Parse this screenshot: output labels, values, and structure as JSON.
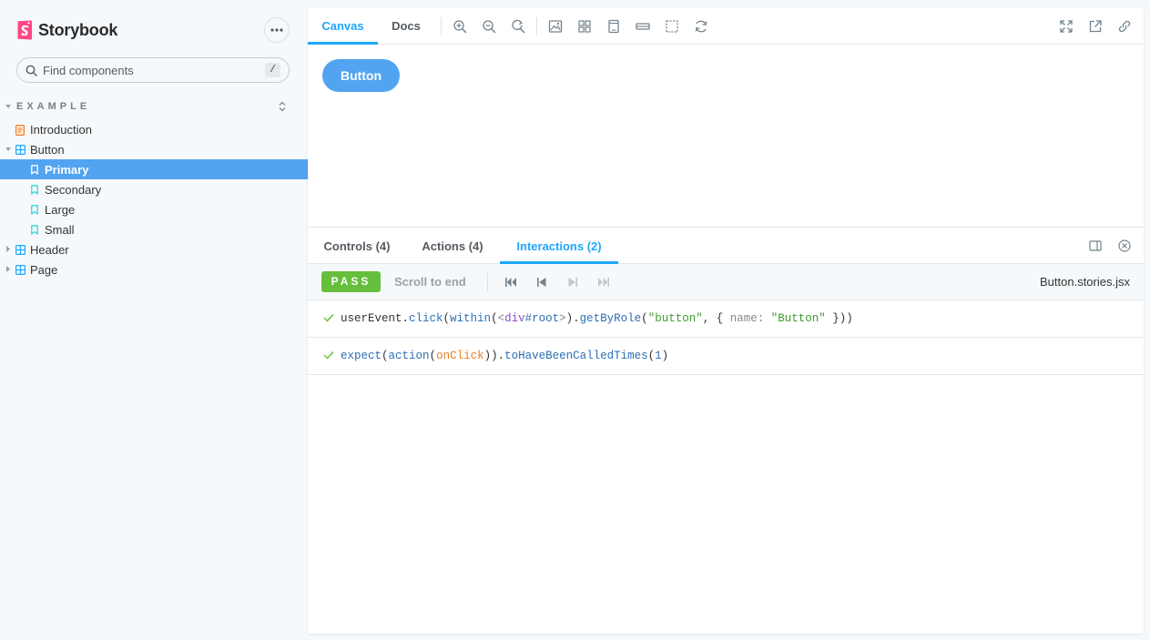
{
  "colors": {
    "accent": "#1ea7fd",
    "selected_bg": "#52a4f1",
    "pass": "#66bf3c",
    "brand_pink": "#ff4785"
  },
  "sidebar": {
    "brand": "Storybook",
    "search_placeholder": "Find components",
    "search_shortcut": "/",
    "group_title": "EXAMPLE",
    "items": [
      {
        "label": "Introduction",
        "icon": "document-icon",
        "depth": 0
      },
      {
        "label": "Button",
        "icon": "component-icon",
        "depth": 0,
        "expanded": true
      },
      {
        "label": "Primary",
        "icon": "bookmark-icon",
        "depth": 1,
        "selected": true
      },
      {
        "label": "Secondary",
        "icon": "bookmark-icon",
        "depth": 1
      },
      {
        "label": "Large",
        "icon": "bookmark-icon",
        "depth": 1
      },
      {
        "label": "Small",
        "icon": "bookmark-icon",
        "depth": 1
      },
      {
        "label": "Header",
        "icon": "component-icon",
        "depth": 0,
        "expanded": false
      },
      {
        "label": "Page",
        "icon": "component-icon",
        "depth": 0,
        "expanded": false
      }
    ]
  },
  "toolbar": {
    "tabs": [
      "Canvas",
      "Docs"
    ],
    "active_tab": "Canvas",
    "tools": [
      "zoom-in-icon",
      "zoom-out-icon",
      "zoom-reset-icon",
      "background-icon",
      "grid-icon",
      "viewport-icon",
      "measure-icon",
      "outline-icon",
      "remount-icon"
    ],
    "right_tools": [
      "fullscreen-icon",
      "open-new-tab-icon",
      "copy-link-icon"
    ]
  },
  "canvas": {
    "button_label": "Button"
  },
  "addons": {
    "tabs": [
      "Controls (4)",
      "Actions (4)",
      "Interactions (2)"
    ],
    "active_tab": "Interactions (2)",
    "status": "PASS",
    "scroll_to_end": "Scroll to end",
    "file_name": "Button.stories.jsx"
  },
  "interactions": [
    {
      "status": "pass",
      "line": [
        {
          "t": "userEvent.",
          "c": "plain"
        },
        {
          "t": "click",
          "c": "fn"
        },
        {
          "t": "(",
          "c": "plain"
        },
        {
          "t": "within",
          "c": "fn"
        },
        {
          "t": "(",
          "c": "plain"
        },
        {
          "t": "<",
          "c": "key"
        },
        {
          "t": "div",
          "c": "el"
        },
        {
          "t": "#root",
          "c": "id"
        },
        {
          "t": ">",
          "c": "key"
        },
        {
          "t": ").",
          "c": "plain"
        },
        {
          "t": "getByRole",
          "c": "fn"
        },
        {
          "t": "(",
          "c": "plain"
        },
        {
          "t": "\"button\"",
          "c": "str"
        },
        {
          "t": ", { ",
          "c": "plain"
        },
        {
          "t": "name: ",
          "c": "key"
        },
        {
          "t": "\"Button\"",
          "c": "str"
        },
        {
          "t": " }))",
          "c": "plain"
        }
      ]
    },
    {
      "status": "pass",
      "line": [
        {
          "t": "expect",
          "c": "fn"
        },
        {
          "t": "(",
          "c": "plain"
        },
        {
          "t": "action",
          "c": "fn"
        },
        {
          "t": "(",
          "c": "plain"
        },
        {
          "t": "onClick",
          "c": "var"
        },
        {
          "t": ")).",
          "c": "plain"
        },
        {
          "t": "toHaveBeenCalledTimes",
          "c": "fn"
        },
        {
          "t": "(",
          "c": "plain"
        },
        {
          "t": "1",
          "c": "num"
        },
        {
          "t": ")",
          "c": "plain"
        }
      ]
    }
  ]
}
